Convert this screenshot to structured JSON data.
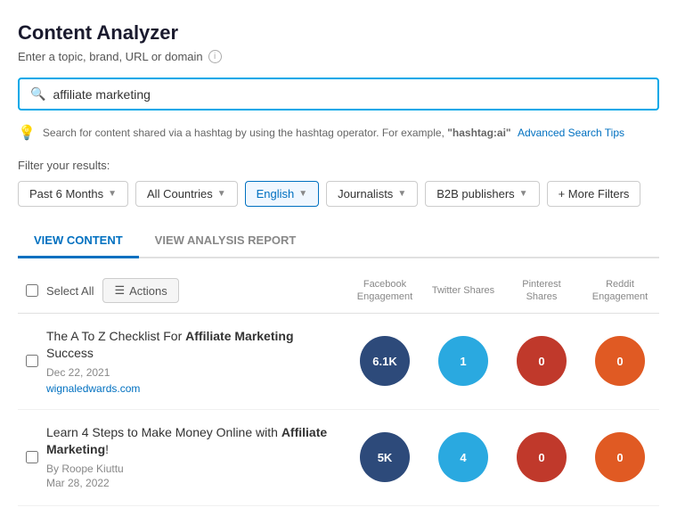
{
  "page": {
    "title": "Content Analyzer",
    "subtitle": "Enter a topic, brand, URL or domain",
    "search_value": "affiliate marketing",
    "hint": {
      "text_before": "Search for content shared via a hashtag by using the hashtag operator. For example,",
      "example": "\"hashtag:ai\"",
      "link_text": "Advanced Search Tips"
    },
    "filter_label": "Filter your results:"
  },
  "filters": {
    "past_months": {
      "label": "Past 6 Months",
      "active": false
    },
    "countries": {
      "label": "All Countries",
      "active": false
    },
    "language": {
      "label": "English",
      "active": true
    },
    "journalists": {
      "label": "Journalists",
      "active": false
    },
    "publishers": {
      "label": "B2B publishers",
      "active": false
    },
    "more": {
      "label": "+ More Filters"
    }
  },
  "tabs": [
    {
      "label": "VIEW CONTENT",
      "active": true
    },
    {
      "label": "VIEW ANALYSIS REPORT",
      "active": false
    }
  ],
  "table": {
    "select_all_label": "Select All",
    "actions_label": "Actions",
    "columns": [
      {
        "label": "Facebook\nEngagement"
      },
      {
        "label": "Twitter Shares"
      },
      {
        "label": "Pinterest\nShares"
      },
      {
        "label": "Reddit\nEngagement"
      }
    ]
  },
  "results": [
    {
      "title_before": "The A To Z Checklist For ",
      "title_bold": "Affiliate Marketing",
      "title_after": " Success",
      "date": "Dec 22, 2021",
      "domain": "wignaledwards.com",
      "by": null,
      "fb": "6.1K",
      "tw": "1",
      "pin": "0",
      "reddit": "0"
    },
    {
      "title_before": "Learn 4 Steps to Make Money Online with ",
      "title_bold": "Affiliate Marketing",
      "title_after": "!",
      "date": "Mar 28, 2022",
      "domain": null,
      "by": "By  Roope Kiuttu",
      "fb": "5K",
      "tw": "4",
      "pin": "0",
      "reddit": "0"
    }
  ]
}
